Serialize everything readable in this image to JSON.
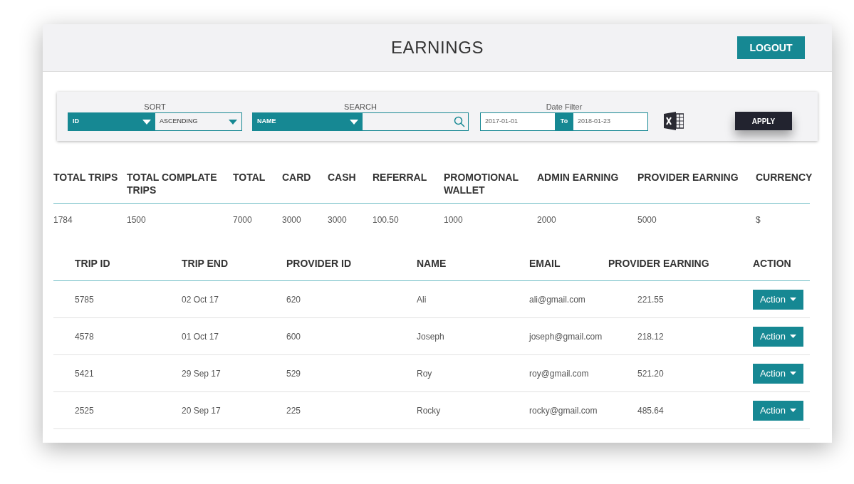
{
  "header": {
    "title": "EARNINGS",
    "logout": "LOGOUT"
  },
  "filters": {
    "sort": {
      "label": "SORT",
      "field": "ID",
      "order": "ASCENDING"
    },
    "search": {
      "label": "SEARCH",
      "field": "NAME"
    },
    "date": {
      "label": "Date Filter",
      "from": "2017-01-01",
      "separator": "To",
      "to": "2018-01-23"
    },
    "apply": "APPLY"
  },
  "summary": {
    "columns": [
      "TOTAL TRIPS",
      "TOTAL COMPLATE TRIPS",
      "TOTAL",
      "CARD",
      "CASH",
      "REFERRAL",
      "PROMOTIONAL WALLET",
      "ADMIN EARNING",
      "PROVIDER EARNING",
      "CURRENCY"
    ],
    "values": [
      "1784",
      "1500",
      "7000",
      "3000",
      "3000",
      "100.50",
      "1000",
      "2000",
      "5000",
      "$"
    ]
  },
  "trips": {
    "columns": [
      "TRIP ID",
      "TRIP END",
      "PROVIDER ID",
      "NAME",
      "EMAIL",
      "PROVIDER EARNING",
      "ACTION"
    ],
    "rows": [
      {
        "cells": [
          "5785",
          "02 Oct 17",
          "620",
          "Ali",
          "ali@gmail.com",
          "221.55"
        ],
        "action": "Action"
      },
      {
        "cells": [
          "4578",
          "01 Oct 17",
          "600",
          "Joseph",
          "joseph@gmail.com",
          "218.12"
        ],
        "action": "Action"
      },
      {
        "cells": [
          "5421",
          "29 Sep 17",
          "529",
          "Roy",
          "roy@gmail.com",
          "521.20"
        ],
        "action": "Action"
      },
      {
        "cells": [
          "2525",
          "20 Sep 17",
          "225",
          "Rocky",
          "rocky@gmail.com",
          "485.64"
        ],
        "action": "Action"
      }
    ]
  }
}
